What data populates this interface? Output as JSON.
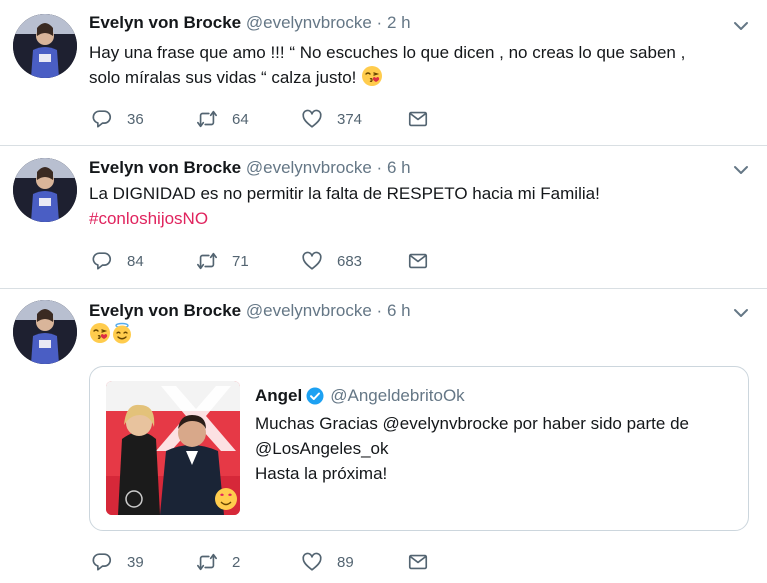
{
  "tweets": [
    {
      "name": "Evelyn von Brocke",
      "handle": "@evelynvbrocke",
      "separator": "·",
      "time": "2 h",
      "text_lines": [
        "Hay una frase que amo !!! “ No escuches lo que dicen , no creas lo que saben ,",
        "solo míralas sus vidas “ calza justo! "
      ],
      "replies": "36",
      "retweets": "64",
      "likes": "374"
    },
    {
      "name": "Evelyn von Brocke",
      "handle": "@evelynvbrocke",
      "separator": "·",
      "time": "6 h",
      "text_lines": [
        "La DIGNIDAD es no permitir la falta de RESPETO hacia mi Familia!"
      ],
      "hashtag": "#conloshijosNO",
      "replies": "84",
      "retweets": "71",
      "likes": "683"
    },
    {
      "name": "Evelyn von Brocke",
      "handle": "@evelynvbrocke",
      "separator": "·",
      "time": "6 h",
      "emojis": [
        "kiss-emoji",
        "angel-emoji"
      ],
      "quoted": {
        "name": "Angel",
        "handle": "@AngeldebritoOk",
        "lines": [
          "Muchas Gracias @evelynvbrocke por haber sido parte de",
          "@LosAngeles_ok",
          "Hasta la próxima!"
        ]
      },
      "replies": "39",
      "retweets": "2",
      "likes": "89"
    }
  ],
  "icons": {
    "reply": "reply-icon",
    "retweet": "retweet-icon",
    "like": "heart-icon",
    "dm": "envelope-icon",
    "caret": "chevron-down-icon",
    "verified": "verified-badge-icon"
  },
  "colors": {
    "text": "#14171a",
    "secondary": "#657786",
    "hashtag": "#e0245e",
    "verified": "#1da1f2",
    "border": "#ccd6dd"
  }
}
